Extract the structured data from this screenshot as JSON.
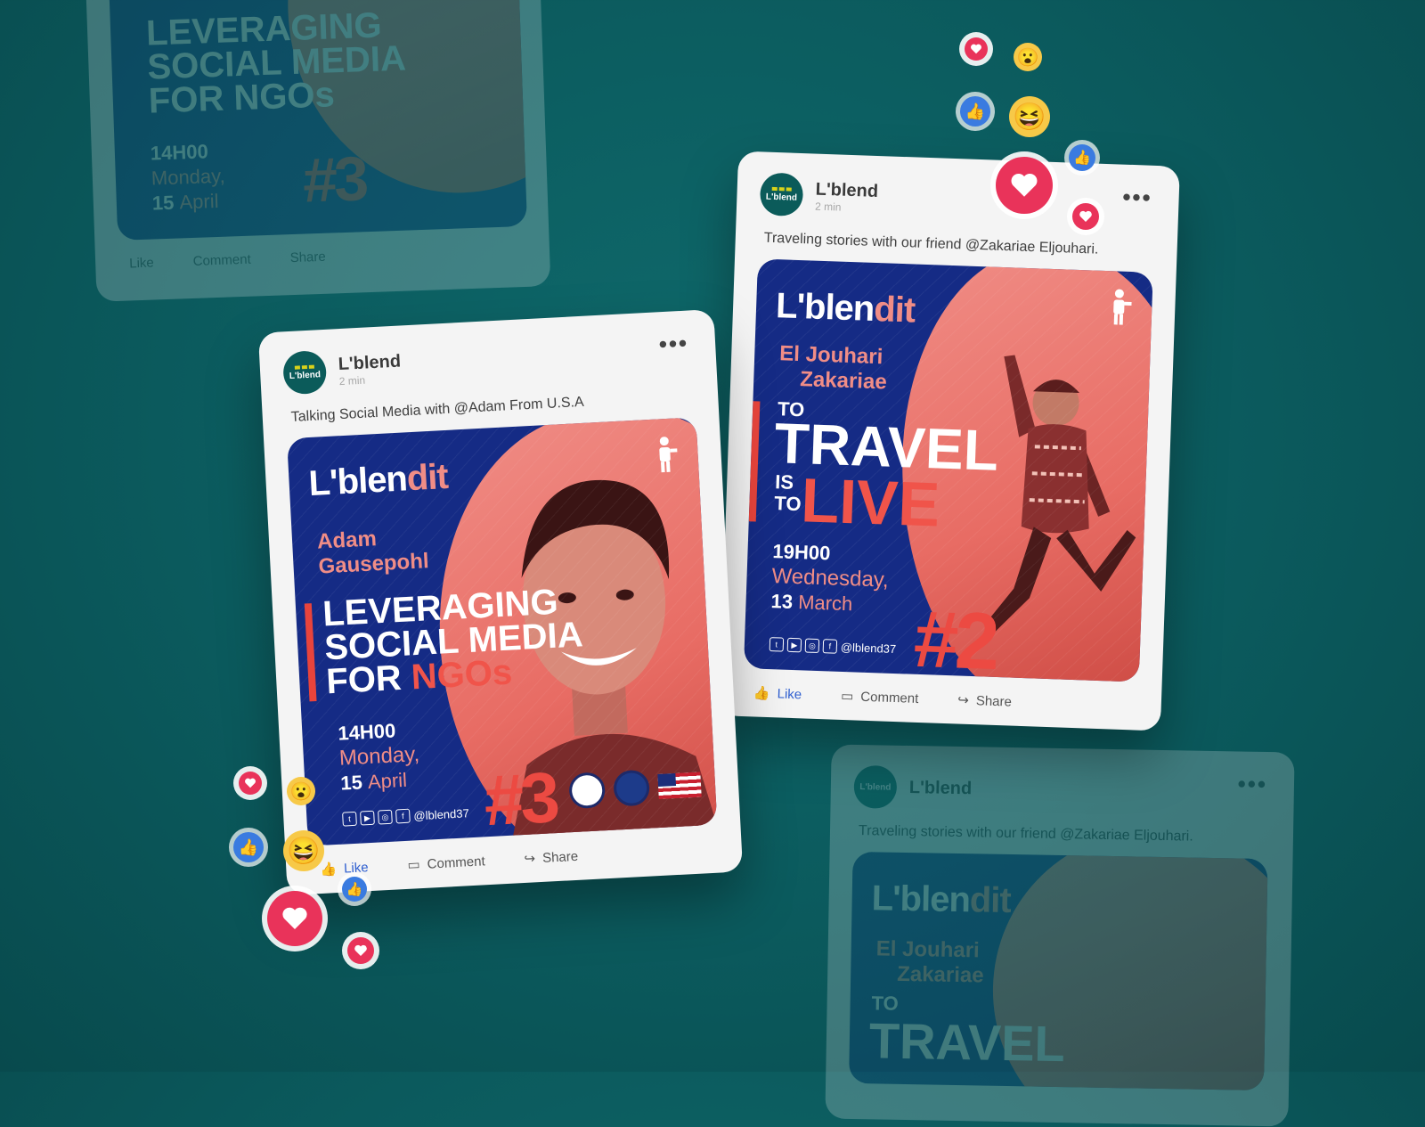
{
  "colors": {
    "background": "#0b5a5d",
    "card": "#f4f4f4",
    "navy": "#152b85",
    "coral": "#f08d86",
    "red": "#ec4a42",
    "like_blue": "#2f5fd0"
  },
  "posts": [
    {
      "author": "L'blend",
      "time": "2 min",
      "logo_text": "L'blend",
      "caption": "Talking Social Media with @Adam From U.S.A",
      "creative": {
        "brand": "L'blen",
        "brand_suffix": "dit",
        "speaker_line1": "Adam",
        "speaker_line2": "Gausepohl",
        "headline_line1": "LEVERAGING",
        "headline_line2": "SOCIAL MEDIA",
        "headline_line3_a": "FOR ",
        "headline_line3_b": "NGOs",
        "time": "14H00",
        "day": "Monday,",
        "date_num": "15",
        "date_month": "April",
        "handle": "@lblend37",
        "episode": "#3"
      },
      "actions": {
        "like": "Like",
        "comment": "Comment",
        "share": "Share"
      }
    },
    {
      "author": "L'blend",
      "time": "2 min",
      "logo_text": "L'blend",
      "caption": "Traveling stories with our friend @Zakariae Eljouhari.",
      "creative": {
        "brand": "L'blen",
        "brand_suffix": "dit",
        "speaker_line1": "El Jouhari",
        "speaker_line2": "Zakariae",
        "headline_to": "TO",
        "headline_travel": "TRAVEL",
        "headline_is": "IS",
        "headline_to2": "TO",
        "headline_live": "LIVE",
        "time": "19H00",
        "day": "Wednesday,",
        "date_num": "13",
        "date_month": "March",
        "handle": "@lblend37",
        "episode": "#2"
      },
      "actions": {
        "like": "Like",
        "comment": "Comment",
        "share": "Share"
      }
    }
  ],
  "icons": [
    "heart-reaction-icon",
    "thumbs-up-reaction-icon",
    "wow-reaction-icon",
    "laugh-reaction-icon",
    "more-options-icon",
    "person-icon"
  ]
}
